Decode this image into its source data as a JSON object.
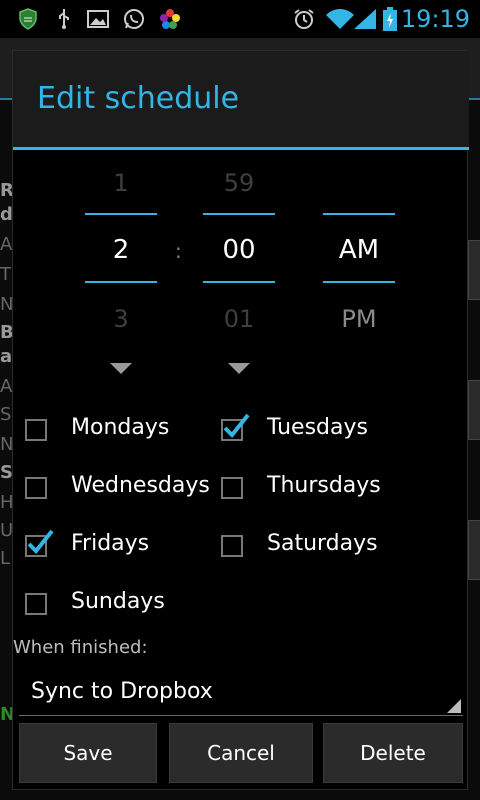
{
  "status_bar": {
    "time": "19:19",
    "icons": [
      "shield-icon",
      "usb-icon",
      "image-icon",
      "whatsapp-icon",
      "photos-icon",
      "alarm-icon",
      "wifi-icon",
      "signal-icon",
      "battery-icon"
    ]
  },
  "background": {
    "letters": [
      "R",
      "d",
      "A",
      "T",
      "N",
      "B",
      "a",
      "A",
      "S",
      "N",
      "S",
      "H",
      "U",
      "L"
    ],
    "bottom_green_letter": "N"
  },
  "dialog": {
    "title": "Edit schedule",
    "time_picker": {
      "hour": {
        "prev": "1",
        "current": "2",
        "next": "3"
      },
      "minute": {
        "prev": "59",
        "current": "00",
        "next": "01"
      },
      "separator": ":",
      "ampm": {
        "current": "AM",
        "next": "PM"
      }
    },
    "days": [
      {
        "label": "Mondays",
        "checked": false
      },
      {
        "label": "Tuesdays",
        "checked": true
      },
      {
        "label": "Wednesdays",
        "checked": false
      },
      {
        "label": "Thursdays",
        "checked": false
      },
      {
        "label": "Fridays",
        "checked": true
      },
      {
        "label": "Saturdays",
        "checked": false
      },
      {
        "label": "Sundays",
        "checked": false
      }
    ],
    "when_finished_label": "When finished:",
    "when_finished_value": "Sync to Dropbox",
    "buttons": {
      "save": "Save",
      "cancel": "Cancel",
      "delete": "Delete"
    }
  },
  "colors": {
    "accent": "#33b5e5",
    "background": "#000000",
    "button": "#2b2b2b"
  }
}
